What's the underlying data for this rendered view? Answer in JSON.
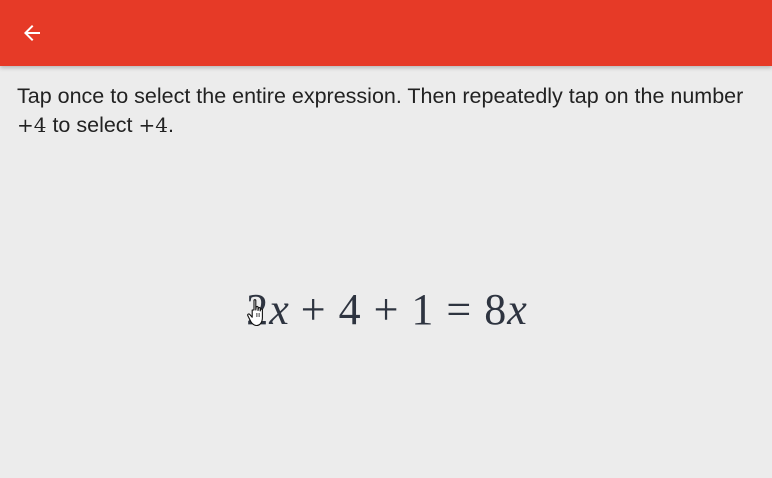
{
  "app_bar": {
    "color": "#e63a27",
    "back_icon": "arrow-back-icon"
  },
  "instructions": {
    "text_1": "Tap once to select the entire expression. Then repeatedly tap on the number ",
    "math_1": "+4",
    "text_2": " to select ",
    "math_2": "+4",
    "text_3": "."
  },
  "expression": {
    "tokens": [
      "2",
      "x",
      "+",
      "4",
      "+",
      "1",
      "=",
      "8",
      "x"
    ]
  },
  "cursor": {
    "icon": "hand-pointer-icon"
  }
}
